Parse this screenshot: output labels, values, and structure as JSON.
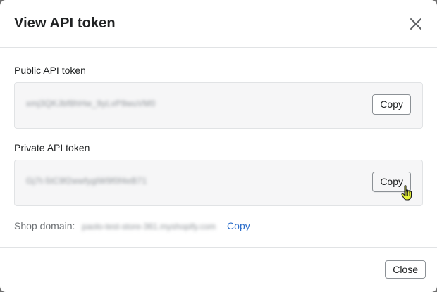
{
  "dialog": {
    "title": "View API token",
    "close_icon": "close-icon"
  },
  "public_token": {
    "label": "Public API token",
    "value": "xmj3QKJbf8hHw_9yLvP9wuVM0",
    "copy_label": "Copy"
  },
  "private_token": {
    "label": "Private API token",
    "value": "Gj7t-5tC9f2wwfyglW9f0f4eB71",
    "copy_label": "Copy"
  },
  "shop": {
    "label": "Shop domain:",
    "value": "paolo-test-store-361.myshopify.com",
    "copy_label": "Copy"
  },
  "footer": {
    "close_label": "Close"
  },
  "colors": {
    "link": "#2c6ecb",
    "cursor": "#e6f23a"
  },
  "cursor_icon": "hand-pointer-icon"
}
